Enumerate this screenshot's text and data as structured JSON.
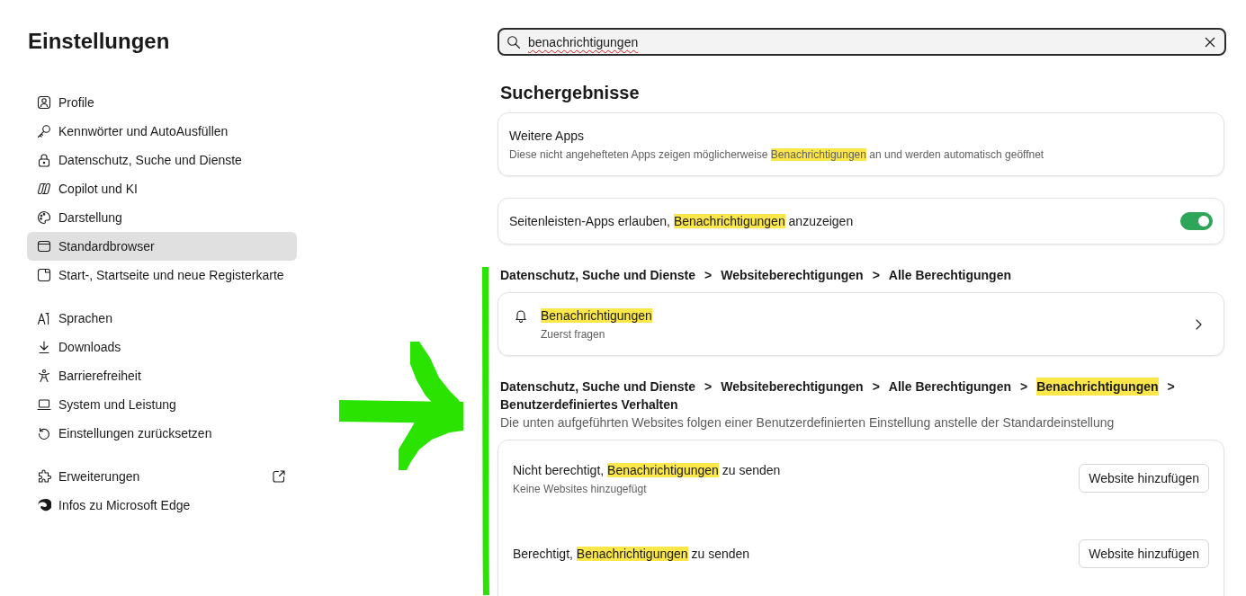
{
  "sidebar": {
    "title": "Einstellungen",
    "groups": [
      {
        "items": [
          {
            "label": "Profile",
            "selected": false,
            "external": false
          },
          {
            "label": "Kennwörter und AutoAusfüllen",
            "selected": false,
            "external": false
          },
          {
            "label": "Datenschutz, Suche und Dienste",
            "selected": false,
            "external": false
          },
          {
            "label": "Copilot und KI",
            "selected": false,
            "external": false
          },
          {
            "label": "Darstellung",
            "selected": false,
            "external": false
          },
          {
            "label": "Standardbrowser",
            "selected": true,
            "external": false
          },
          {
            "label": "Start-, Startseite und neue Registerkarte",
            "selected": false,
            "external": false
          }
        ]
      },
      {
        "items": [
          {
            "label": "Sprachen",
            "selected": false,
            "external": false
          },
          {
            "label": "Downloads",
            "selected": false,
            "external": false
          },
          {
            "label": "Barrierefreiheit",
            "selected": false,
            "external": false
          },
          {
            "label": "System und Leistung",
            "selected": false,
            "external": false
          },
          {
            "label": "Einstellungen zurücksetzen",
            "selected": false,
            "external": false
          }
        ]
      },
      {
        "items": [
          {
            "label": "Erweiterungen",
            "selected": false,
            "external": true
          },
          {
            "label": "Infos zu Microsoft Edge",
            "selected": false,
            "external": false
          }
        ]
      }
    ]
  },
  "search": {
    "value": "benachrichtigungen",
    "misspelled": true
  },
  "results": {
    "heading": "Suchergebnisse",
    "blocks": [
      {
        "kind": "info",
        "title": "Weitere Apps",
        "description": [
          {
            "text": "Diese nicht angehefteten Apps zeigen möglicherweise ",
            "highlight": false
          },
          {
            "text": "Benachrichtigungen",
            "highlight": true
          },
          {
            "text": " an und werden automatisch geöffnet",
            "highlight": false
          }
        ]
      },
      {
        "kind": "toggle",
        "label": [
          {
            "text": "Seitenleisten-Apps erlauben, ",
            "highlight": false
          },
          {
            "text": "Benachrichtigungen",
            "highlight": true
          },
          {
            "text": " anzuzeigen",
            "highlight": false
          }
        ],
        "on": true
      },
      {
        "kind": "breadcrumb",
        "items": [
          {
            "text": "Datenschutz, Suche und Dienste",
            "highlight": false,
            "separator": ">"
          },
          {
            "text": "Websiteberechtigungen",
            "highlight": false,
            "separator": ">"
          },
          {
            "text": "Alle Berechtigungen",
            "highlight": false
          }
        ]
      },
      {
        "kind": "link",
        "title": [
          {
            "text": "Benachrichtigungen",
            "highlight": true
          }
        ],
        "subtitle": "Zuerst fragen"
      },
      {
        "kind": "breadcrumb",
        "items": [
          {
            "text": "Datenschutz, Suche und Dienste",
            "highlight": false,
            "separator": ">"
          },
          {
            "text": "Websiteberechtigungen",
            "highlight": false,
            "separator": ">"
          },
          {
            "text": "Alle Berechtigungen",
            "highlight": false,
            "separator": ">"
          },
          {
            "text": "Benachrichtigungen",
            "highlight": true,
            "separator": ">"
          },
          {
            "text": "Benutzerdefiniertes Verhalten",
            "highlight": false
          }
        ]
      },
      {
        "kind": "note",
        "text": "Die unten aufgeführten Websites folgen einer Benutzerdefinierten Einstellung anstelle der Standardeinstellung"
      },
      {
        "kind": "site_list",
        "rows": [
          {
            "title": [
              {
                "text": "Nicht berechtigt, ",
                "highlight": false
              },
              {
                "text": "Benachrichtigungen",
                "highlight": true
              },
              {
                "text": " zu senden",
                "highlight": false
              }
            ],
            "subtitle": "Keine Websites hinzugefügt",
            "button": "Website hinzufügen"
          },
          {
            "title": [
              {
                "text": "Berechtigt, ",
                "highlight": false
              },
              {
                "text": "Benachrichtigungen",
                "highlight": true
              },
              {
                "text": " zu senden",
                "highlight": false
              }
            ],
            "button": "Website hinzufügen"
          }
        ]
      }
    ]
  },
  "annotation": {
    "line": true,
    "arrow": true
  }
}
